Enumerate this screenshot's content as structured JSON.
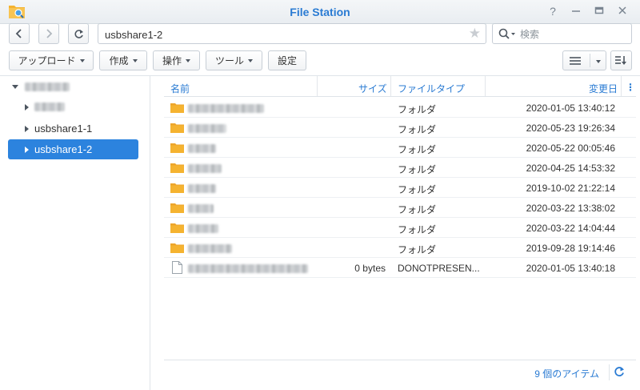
{
  "window": {
    "title": "File Station",
    "help_label": "?"
  },
  "nav": {
    "path": "usbshare1-2",
    "search_placeholder": "検索"
  },
  "toolbar": {
    "upload_label": "アップロード",
    "create_label": "作成",
    "action_label": "操作",
    "tools_label": "ツール",
    "settings_label": "設定"
  },
  "tree": {
    "items": [
      {
        "label": "",
        "obscured": true,
        "expanded": true
      },
      {
        "label": "",
        "obscured": true
      },
      {
        "label": "usbshare1-1"
      },
      {
        "label": "usbshare1-2",
        "selected": true
      }
    ]
  },
  "list": {
    "headers": {
      "name": "名前",
      "size": "サイズ",
      "type": "ファイルタイプ",
      "modified": "変更日"
    },
    "rows": [
      {
        "name": "",
        "size": "",
        "type": "フォルダ",
        "modified": "2020-01-05 13:40:12",
        "icon": "folder-icon"
      },
      {
        "name": "",
        "size": "",
        "type": "フォルダ",
        "modified": "2020-05-23 19:26:34",
        "icon": "folder-icon"
      },
      {
        "name": "",
        "size": "",
        "type": "フォルダ",
        "modified": "2020-05-22 00:05:46",
        "icon": "folder-icon"
      },
      {
        "name": "",
        "size": "",
        "type": "フォルダ",
        "modified": "2020-04-25 14:53:32",
        "icon": "folder-icon"
      },
      {
        "name": "",
        "size": "",
        "type": "フォルダ",
        "modified": "2019-10-02 21:22:14",
        "icon": "folder-icon"
      },
      {
        "name": "",
        "size": "",
        "type": "フォルダ",
        "modified": "2020-03-22 13:38:02",
        "icon": "folder-icon"
      },
      {
        "name": "",
        "size": "",
        "type": "フォルダ",
        "modified": "2020-03-22 14:04:44",
        "icon": "folder-icon"
      },
      {
        "name": "",
        "size": "",
        "type": "フォルダ",
        "modified": "2019-09-28 19:14:46",
        "icon": "folder-icon"
      },
      {
        "name": "",
        "size": "0 bytes",
        "type": "DONOTPRESEN...",
        "modified": "2020-01-05 13:40:18",
        "icon": "file-icon"
      }
    ],
    "item_count": "9 個のアイテム"
  },
  "colors": {
    "accent": "#2a7bd3",
    "selected": "#2c83de",
    "folder": "#f5b330"
  }
}
